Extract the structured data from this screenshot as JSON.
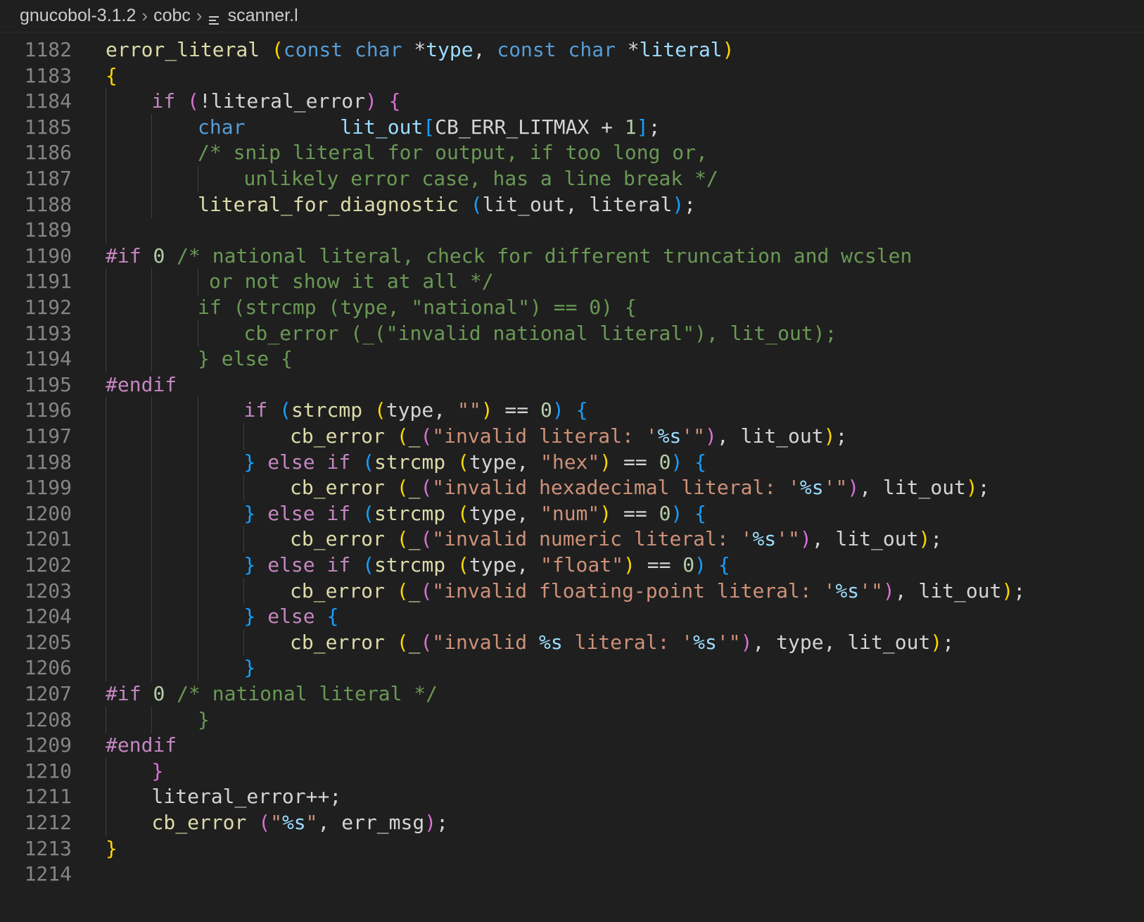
{
  "breadcrumb": {
    "segments": [
      "gnucobol-3.1.2",
      "cobc",
      "scanner.l"
    ],
    "file_icon": "text-file-icon",
    "separator_icon": "chevron-right-icon"
  },
  "colors": {
    "background": "#1f1f1f",
    "line_number": "#858585",
    "keyword_control": "#c586c0",
    "keyword_type": "#569cd6",
    "variable": "#9cdcfe",
    "function": "#dcdcaa",
    "string": "#ce9178",
    "number": "#b5cea8",
    "comment": "#6a9955",
    "bracket_level_1": "#ffd700",
    "bracket_level_2": "#da70d6",
    "bracket_level_3": "#179fff"
  },
  "editor": {
    "lines": [
      {
        "n": "1182",
        "indent": 0,
        "guides": 0,
        "tokens": [
          [
            "fn",
            "error_literal"
          ],
          [
            "plain",
            " "
          ],
          [
            "b1",
            "("
          ],
          [
            "kw-blue",
            "const"
          ],
          [
            "plain",
            " "
          ],
          [
            "kw-blue",
            "char"
          ],
          [
            "plain",
            " *"
          ],
          [
            "var",
            "type"
          ],
          [
            "plain",
            ", "
          ],
          [
            "kw-blue",
            "const"
          ],
          [
            "plain",
            " "
          ],
          [
            "kw-blue",
            "char"
          ],
          [
            "plain",
            " *"
          ],
          [
            "var",
            "literal"
          ],
          [
            "b1",
            ")"
          ]
        ]
      },
      {
        "n": "1183",
        "indent": 0,
        "guides": 0,
        "tokens": [
          [
            "b1",
            "{"
          ]
        ]
      },
      {
        "n": "1184",
        "indent": 1,
        "guides": 1,
        "tokens": [
          [
            "kw-purple",
            "if"
          ],
          [
            "plain",
            " "
          ],
          [
            "b2",
            "("
          ],
          [
            "plain",
            "!literal_error"
          ],
          [
            "b2",
            ")"
          ],
          [
            "plain",
            " "
          ],
          [
            "b2",
            "{"
          ]
        ]
      },
      {
        "n": "1185",
        "indent": 2,
        "guides": 2,
        "tokens": [
          [
            "kw-blue",
            "char"
          ],
          [
            "plain",
            "        "
          ],
          [
            "var",
            "lit_out"
          ],
          [
            "b3",
            "["
          ],
          [
            "plain",
            "CB_ERR_LITMAX + "
          ],
          [
            "num",
            "1"
          ],
          [
            "b3",
            "]"
          ],
          [
            "plain",
            ";"
          ]
        ]
      },
      {
        "n": "1186",
        "indent": 2,
        "guides": 2,
        "tokens": [
          [
            "cm",
            "/* snip literal for output, if too long or,"
          ]
        ]
      },
      {
        "n": "1187",
        "indent": 3,
        "guides": 3,
        "tokens": [
          [
            "cm",
            "unlikely error case, has a line break */"
          ]
        ]
      },
      {
        "n": "1188",
        "indent": 2,
        "guides": 2,
        "tokens": [
          [
            "fn",
            "literal_for_diagnostic"
          ],
          [
            "plain",
            " "
          ],
          [
            "b3",
            "("
          ],
          [
            "plain",
            "lit_out, literal"
          ],
          [
            "b3",
            ")"
          ],
          [
            "plain",
            ";"
          ]
        ]
      },
      {
        "n": "1189",
        "indent": 0,
        "guides": 1,
        "tokens": []
      },
      {
        "n": "1190",
        "indent": 0,
        "guides": 0,
        "tokens": [
          [
            "kw-purple",
            "#if"
          ],
          [
            "plain",
            " "
          ],
          [
            "num",
            "0"
          ],
          [
            "plain",
            " "
          ],
          [
            "cm",
            "/* national literal, check for different truncation and wcslen"
          ]
        ]
      },
      {
        "n": "1191",
        "indent": 2,
        "guides": 3,
        "offset": 16,
        "tokens": [
          [
            "cm",
            "or not show it at all */"
          ]
        ]
      },
      {
        "n": "1192",
        "indent": 2,
        "guides": 2,
        "tokens": [
          [
            "cm",
            "if (strcmp (type, \"national\") == 0) {"
          ]
        ]
      },
      {
        "n": "1193",
        "indent": 3,
        "guides": 3,
        "tokens": [
          [
            "cm",
            "cb_error (_(\"invalid national literal\"), lit_out);"
          ]
        ]
      },
      {
        "n": "1194",
        "indent": 2,
        "guides": 2,
        "tokens": [
          [
            "cm",
            "} else {"
          ]
        ]
      },
      {
        "n": "1195",
        "indent": 0,
        "guides": 0,
        "tokens": [
          [
            "kw-purple",
            "#endif"
          ]
        ]
      },
      {
        "n": "1196",
        "indent": 3,
        "guides": 3,
        "tokens": [
          [
            "kw-purple",
            "if"
          ],
          [
            "plain",
            " "
          ],
          [
            "b3",
            "("
          ],
          [
            "fn",
            "strcmp"
          ],
          [
            "plain",
            " "
          ],
          [
            "b1",
            "("
          ],
          [
            "plain",
            "type, "
          ],
          [
            "str",
            "\"\""
          ],
          [
            "b1",
            ")"
          ],
          [
            "plain",
            " == "
          ],
          [
            "num",
            "0"
          ],
          [
            "b3",
            ")"
          ],
          [
            "plain",
            " "
          ],
          [
            "b3",
            "{"
          ]
        ]
      },
      {
        "n": "1197",
        "indent": 4,
        "guides": 4,
        "tokens": [
          [
            "fn",
            "cb_error"
          ],
          [
            "plain",
            " "
          ],
          [
            "b1",
            "("
          ],
          [
            "fn",
            "_"
          ],
          [
            "b2",
            "("
          ],
          [
            "str",
            "\"invalid literal: '"
          ],
          [
            "esc",
            "%s"
          ],
          [
            "str",
            "'\""
          ],
          [
            "b2",
            ")"
          ],
          [
            "plain",
            ", lit_out"
          ],
          [
            "b1",
            ")"
          ],
          [
            "plain",
            ";"
          ]
        ]
      },
      {
        "n": "1198",
        "indent": 3,
        "guides": 3,
        "tokens": [
          [
            "b3",
            "}"
          ],
          [
            "plain",
            " "
          ],
          [
            "kw-purple",
            "else if"
          ],
          [
            "plain",
            " "
          ],
          [
            "b3",
            "("
          ],
          [
            "fn",
            "strcmp"
          ],
          [
            "plain",
            " "
          ],
          [
            "b1",
            "("
          ],
          [
            "plain",
            "type, "
          ],
          [
            "str",
            "\"hex\""
          ],
          [
            "b1",
            ")"
          ],
          [
            "plain",
            " == "
          ],
          [
            "num",
            "0"
          ],
          [
            "b3",
            ")"
          ],
          [
            "plain",
            " "
          ],
          [
            "b3",
            "{"
          ]
        ]
      },
      {
        "n": "1199",
        "indent": 4,
        "guides": 4,
        "tokens": [
          [
            "fn",
            "cb_error"
          ],
          [
            "plain",
            " "
          ],
          [
            "b1",
            "("
          ],
          [
            "fn",
            "_"
          ],
          [
            "b2",
            "("
          ],
          [
            "str",
            "\"invalid hexadecimal literal: '"
          ],
          [
            "esc",
            "%s"
          ],
          [
            "str",
            "'\""
          ],
          [
            "b2",
            ")"
          ],
          [
            "plain",
            ", lit_out"
          ],
          [
            "b1",
            ")"
          ],
          [
            "plain",
            ";"
          ]
        ]
      },
      {
        "n": "1200",
        "indent": 3,
        "guides": 3,
        "tokens": [
          [
            "b3",
            "}"
          ],
          [
            "plain",
            " "
          ],
          [
            "kw-purple",
            "else if"
          ],
          [
            "plain",
            " "
          ],
          [
            "b3",
            "("
          ],
          [
            "fn",
            "strcmp"
          ],
          [
            "plain",
            " "
          ],
          [
            "b1",
            "("
          ],
          [
            "plain",
            "type, "
          ],
          [
            "str",
            "\"num\""
          ],
          [
            "b1",
            ")"
          ],
          [
            "plain",
            " == "
          ],
          [
            "num",
            "0"
          ],
          [
            "b3",
            ")"
          ],
          [
            "plain",
            " "
          ],
          [
            "b3",
            "{"
          ]
        ]
      },
      {
        "n": "1201",
        "indent": 4,
        "guides": 4,
        "tokens": [
          [
            "fn",
            "cb_error"
          ],
          [
            "plain",
            " "
          ],
          [
            "b1",
            "("
          ],
          [
            "fn",
            "_"
          ],
          [
            "b2",
            "("
          ],
          [
            "str",
            "\"invalid numeric literal: '"
          ],
          [
            "esc",
            "%s"
          ],
          [
            "str",
            "'\""
          ],
          [
            "b2",
            ")"
          ],
          [
            "plain",
            ", lit_out"
          ],
          [
            "b1",
            ")"
          ],
          [
            "plain",
            ";"
          ]
        ]
      },
      {
        "n": "1202",
        "indent": 3,
        "guides": 3,
        "tokens": [
          [
            "b3",
            "}"
          ],
          [
            "plain",
            " "
          ],
          [
            "kw-purple",
            "else if"
          ],
          [
            "plain",
            " "
          ],
          [
            "b3",
            "("
          ],
          [
            "fn",
            "strcmp"
          ],
          [
            "plain",
            " "
          ],
          [
            "b1",
            "("
          ],
          [
            "plain",
            "type, "
          ],
          [
            "str",
            "\"float\""
          ],
          [
            "b1",
            ")"
          ],
          [
            "plain",
            " == "
          ],
          [
            "num",
            "0"
          ],
          [
            "b3",
            ")"
          ],
          [
            "plain",
            " "
          ],
          [
            "b3",
            "{"
          ]
        ]
      },
      {
        "n": "1203",
        "indent": 4,
        "guides": 4,
        "tokens": [
          [
            "fn",
            "cb_error"
          ],
          [
            "plain",
            " "
          ],
          [
            "b1",
            "("
          ],
          [
            "fn",
            "_"
          ],
          [
            "b2",
            "("
          ],
          [
            "str",
            "\"invalid floating-point literal: '"
          ],
          [
            "esc",
            "%s"
          ],
          [
            "str",
            "'\""
          ],
          [
            "b2",
            ")"
          ],
          [
            "plain",
            ", lit_out"
          ],
          [
            "b1",
            ")"
          ],
          [
            "plain",
            ";"
          ]
        ]
      },
      {
        "n": "1204",
        "indent": 3,
        "guides": 3,
        "tokens": [
          [
            "b3",
            "}"
          ],
          [
            "plain",
            " "
          ],
          [
            "kw-purple",
            "else"
          ],
          [
            "plain",
            " "
          ],
          [
            "b3",
            "{"
          ]
        ]
      },
      {
        "n": "1205",
        "indent": 4,
        "guides": 4,
        "tokens": [
          [
            "fn",
            "cb_error"
          ],
          [
            "plain",
            " "
          ],
          [
            "b1",
            "("
          ],
          [
            "fn",
            "_"
          ],
          [
            "b2",
            "("
          ],
          [
            "str",
            "\"invalid "
          ],
          [
            "esc",
            "%s"
          ],
          [
            "str",
            " literal: '"
          ],
          [
            "esc",
            "%s"
          ],
          [
            "str",
            "'\""
          ],
          [
            "b2",
            ")"
          ],
          [
            "plain",
            ", type, lit_out"
          ],
          [
            "b1",
            ")"
          ],
          [
            "plain",
            ";"
          ]
        ]
      },
      {
        "n": "1206",
        "indent": 3,
        "guides": 3,
        "tokens": [
          [
            "b3",
            "}"
          ]
        ]
      },
      {
        "n": "1207",
        "indent": 0,
        "guides": 0,
        "tokens": [
          [
            "kw-purple",
            "#if"
          ],
          [
            "plain",
            " "
          ],
          [
            "num",
            "0"
          ],
          [
            "plain",
            " "
          ],
          [
            "cm",
            "/* national literal */"
          ]
        ]
      },
      {
        "n": "1208",
        "indent": 2,
        "guides": 2,
        "tokens": [
          [
            "cm",
            "}"
          ]
        ]
      },
      {
        "n": "1209",
        "indent": 0,
        "guides": 0,
        "tokens": [
          [
            "kw-purple",
            "#endif"
          ]
        ]
      },
      {
        "n": "1210",
        "indent": 1,
        "guides": 1,
        "tokens": [
          [
            "b2",
            "}"
          ]
        ]
      },
      {
        "n": "1211",
        "indent": 1,
        "guides": 1,
        "tokens": [
          [
            "plain",
            "literal_error++;"
          ]
        ]
      },
      {
        "n": "1212",
        "indent": 1,
        "guides": 1,
        "tokens": [
          [
            "fn",
            "cb_error"
          ],
          [
            "plain",
            " "
          ],
          [
            "b2",
            "("
          ],
          [
            "str",
            "\""
          ],
          [
            "esc",
            "%s"
          ],
          [
            "str",
            "\""
          ],
          [
            "plain",
            ", err_msg"
          ],
          [
            "b2",
            ")"
          ],
          [
            "plain",
            ";"
          ]
        ]
      },
      {
        "n": "1213",
        "indent": 0,
        "guides": 0,
        "tokens": [
          [
            "b1",
            "}"
          ]
        ]
      },
      {
        "n": "1214",
        "indent": 0,
        "guides": 0,
        "tokens": []
      }
    ]
  }
}
